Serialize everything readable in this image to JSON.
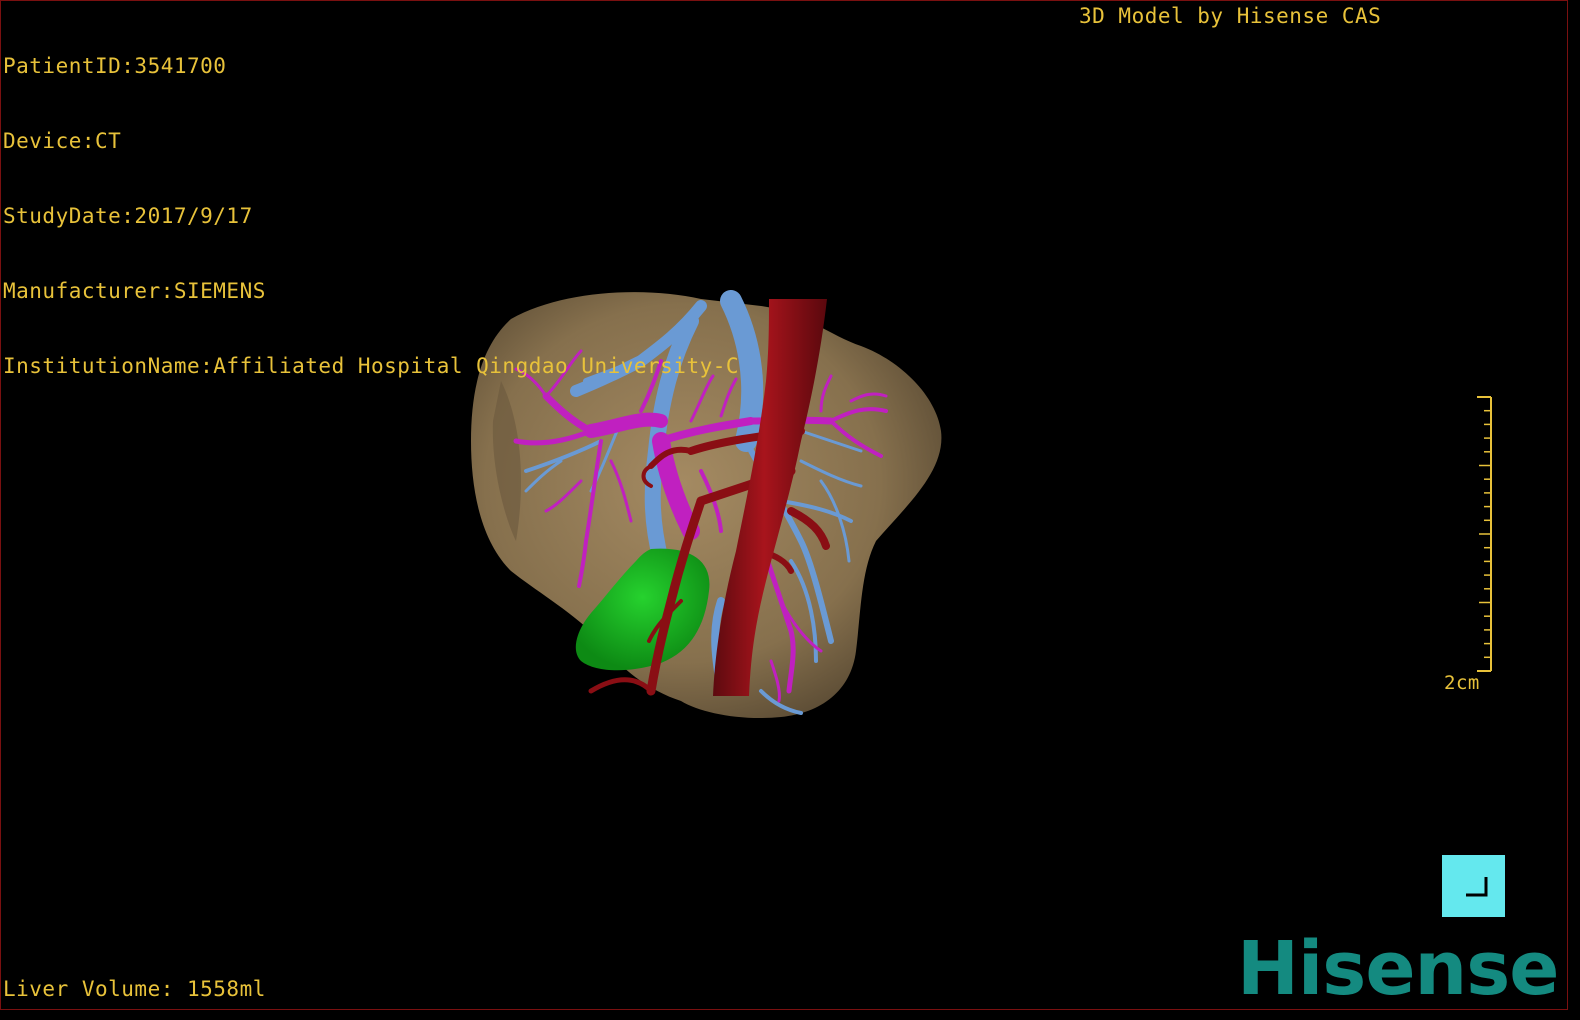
{
  "info": {
    "patient_id": "PatientID:3541700",
    "device": "Device:CT",
    "study_date": "StudyDate:2017/9/17",
    "manufacturer": "Manufacturer:SIEMENS",
    "institution": "InstitutionName:Affiliated Hospital Qingdao University-C"
  },
  "watermark": "3D Model by Hisense CAS",
  "liver_volume": "Liver Volume: 1558ml",
  "scale_bar": {
    "label": "2cm"
  },
  "logo": "Hisense",
  "colors": {
    "text": "#e8c23a",
    "liver": "#8a7250",
    "hepatic_vein": "#6a9ad4",
    "portal_vein": "#c020c0",
    "artery": "#8a0e14",
    "gallbladder": "#18b020",
    "button": "#64e8ee",
    "logo": "#148a80"
  },
  "icons": {
    "corner_button": "corner-bracket-icon"
  }
}
